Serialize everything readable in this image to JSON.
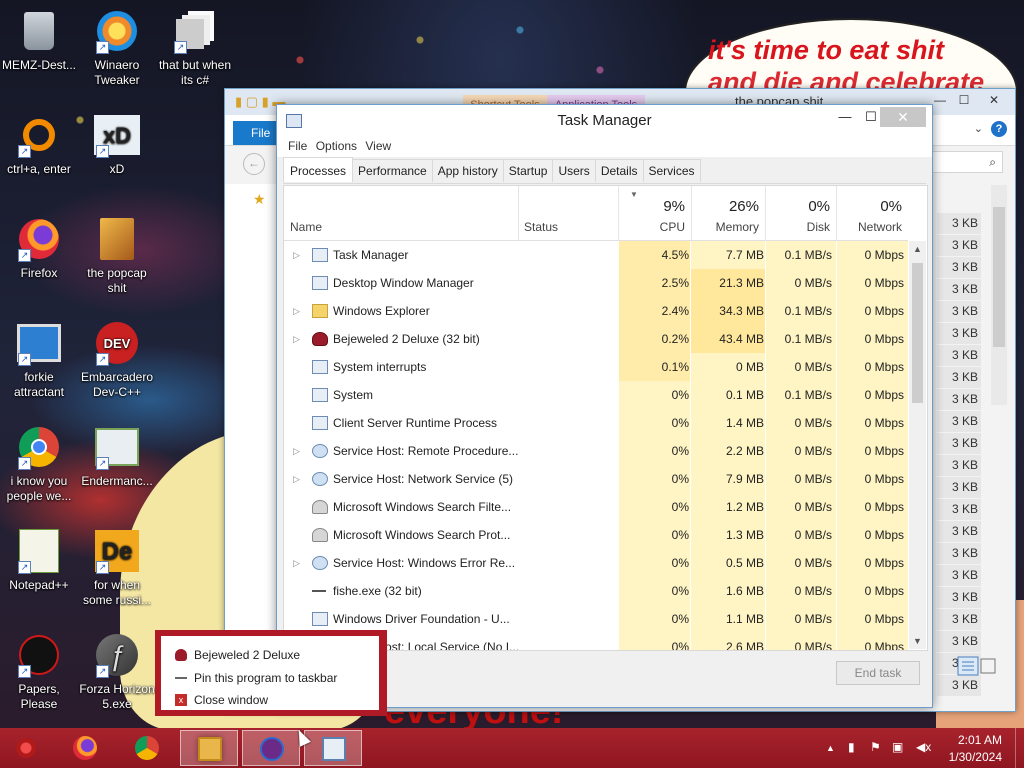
{
  "wallpaper": {
    "caption_line1": "it's time to eat shit",
    "caption_line2": "and die and celebrate",
    "bottom_text": "everyone!"
  },
  "desktop_icons": [
    {
      "label": "MEMZ-Dest...",
      "icon": "recycle-bin-icon",
      "shortcut": false
    },
    {
      "label": "Winaero Tweaker",
      "icon": "winaero-icon",
      "shortcut": true
    },
    {
      "label": "that but when its c#",
      "icon": "stack-icon",
      "shortcut": true
    },
    {
      "label": "ctrl+a, enter",
      "icon": "ring-icon",
      "shortcut": true
    },
    {
      "label": "xD",
      "icon": "xd-icon",
      "shortcut": true
    },
    {
      "label": "Firefox",
      "icon": "firefox-icon",
      "shortcut": true
    },
    {
      "label": "the popcap shit",
      "icon": "popcap-icon",
      "shortcut": false
    },
    {
      "label": "forkie attractant",
      "icon": "forkie-icon",
      "shortcut": true
    },
    {
      "label": "Embarcadero Dev-C++",
      "icon": "devcpp-icon",
      "shortcut": true
    },
    {
      "label": "i know you people we...",
      "icon": "chrome-icon",
      "shortcut": true
    },
    {
      "label": "Endermanc...",
      "icon": "enderman-icon",
      "shortcut": true
    },
    {
      "label": "Notepad++",
      "icon": "notepadpp-icon",
      "shortcut": true
    },
    {
      "label": "for when some russi...",
      "icon": "de-icon",
      "shortcut": true
    },
    {
      "label": "Papers, Please",
      "icon": "papers-please-icon",
      "shortcut": true
    },
    {
      "label": "Forza Horizon 5.exe",
      "icon": "flash-icon",
      "shortcut": true
    }
  ],
  "explorer": {
    "title": "the popcap shit",
    "context_tab1": "Shortcut Tools",
    "context_tab2": "Application Tools",
    "file_tab": "File",
    "minimize": "—",
    "maximize": "☐",
    "close": "✕",
    "sizes": [
      "3 KB",
      "3 KB",
      "3 KB",
      "3 KB",
      "3 KB",
      "3 KB",
      "3 KB",
      "3 KB",
      "3 KB",
      "3 KB",
      "3 KB",
      "3 KB",
      "3 KB",
      "3 KB",
      "3 KB",
      "3 KB",
      "3 KB",
      "3 KB",
      "3 KB",
      "3 KB",
      "3 KB",
      "3 KB"
    ]
  },
  "taskmanager": {
    "title": "Task Manager",
    "menu": [
      "File",
      "Options",
      "View"
    ],
    "tabs": [
      "Processes",
      "Performance",
      "App history",
      "Startup",
      "Users",
      "Details",
      "Services"
    ],
    "active_tab": "Processes",
    "columns": {
      "name": "Name",
      "status": "Status",
      "cpu_pct": "9%",
      "cpu": "CPU",
      "memory_pct": "26%",
      "memory": "Memory",
      "disk_pct": "0%",
      "disk": "Disk",
      "network_pct": "0%",
      "network": "Network"
    },
    "processes": [
      {
        "name": "Task Manager",
        "cpu": "4.5%",
        "memory": "7.7 MB",
        "disk": "0.1 MB/s",
        "network": "0 Mbps",
        "expandable": true,
        "icon": "taskmgr"
      },
      {
        "name": "Desktop Window Manager",
        "cpu": "2.5%",
        "memory": "21.3 MB",
        "disk": "0 MB/s",
        "network": "0 Mbps",
        "expandable": false,
        "icon": "window"
      },
      {
        "name": "Windows Explorer",
        "cpu": "2.4%",
        "memory": "34.3 MB",
        "disk": "0.1 MB/s",
        "network": "0 Mbps",
        "expandable": true,
        "icon": "folder"
      },
      {
        "name": "Bejeweled 2 Deluxe (32 bit)",
        "cpu": "0.2%",
        "memory": "43.4 MB",
        "disk": "0.1 MB/s",
        "network": "0 Mbps",
        "expandable": true,
        "icon": "bejeweled"
      },
      {
        "name": "System interrupts",
        "cpu": "0.1%",
        "memory": "0 MB",
        "disk": "0 MB/s",
        "network": "0 Mbps",
        "expandable": false,
        "icon": "window"
      },
      {
        "name": "System",
        "cpu": "0%",
        "memory": "0.1 MB",
        "disk": "0.1 MB/s",
        "network": "0 Mbps",
        "expandable": false,
        "icon": "window"
      },
      {
        "name": "Client Server Runtime Process",
        "cpu": "0%",
        "memory": "1.4 MB",
        "disk": "0 MB/s",
        "network": "0 Mbps",
        "expandable": false,
        "icon": "window"
      },
      {
        "name": "Service Host: Remote Procedure...",
        "cpu": "0%",
        "memory": "2.2 MB",
        "disk": "0 MB/s",
        "network": "0 Mbps",
        "expandable": true,
        "icon": "gear"
      },
      {
        "name": "Service Host: Network Service (5)",
        "cpu": "0%",
        "memory": "7.9 MB",
        "disk": "0 MB/s",
        "network": "0 Mbps",
        "expandable": true,
        "icon": "gear"
      },
      {
        "name": "Microsoft Windows Search Filte...",
        "cpu": "0%",
        "memory": "1.2 MB",
        "disk": "0 MB/s",
        "network": "0 Mbps",
        "expandable": false,
        "icon": "user"
      },
      {
        "name": "Microsoft Windows Search Prot...",
        "cpu": "0%",
        "memory": "1.3 MB",
        "disk": "0 MB/s",
        "network": "0 Mbps",
        "expandable": false,
        "icon": "user"
      },
      {
        "name": "Service Host: Windows Error Re...",
        "cpu": "0%",
        "memory": "0.5 MB",
        "disk": "0 MB/s",
        "network": "0 Mbps",
        "expandable": true,
        "icon": "gear"
      },
      {
        "name": "fishe.exe (32 bit)",
        "cpu": "0%",
        "memory": "1.6 MB",
        "disk": "0 MB/s",
        "network": "0 Mbps",
        "expandable": false,
        "icon": "fish"
      },
      {
        "name": "Windows Driver Foundation - U...",
        "cpu": "0%",
        "memory": "1.1 MB",
        "disk": "0 MB/s",
        "network": "0 Mbps",
        "expandable": false,
        "icon": "window"
      },
      {
        "name": "Service Host: Local Service (No I...",
        "cpu": "0%",
        "memory": "2.6 MB",
        "disk": "0 MB/s",
        "network": "0 Mbps",
        "expandable": true,
        "icon": "gear"
      }
    ],
    "end_task": "End task"
  },
  "jumplist": {
    "items": [
      "Bejeweled 2 Deluxe",
      "Pin this program to taskbar",
      "Close window"
    ]
  },
  "taskbar": {
    "time": "2:01 AM",
    "date": "1/30/2024",
    "colors": {
      "taskbar": "#a8232c",
      "accent": "#1979ca"
    }
  }
}
